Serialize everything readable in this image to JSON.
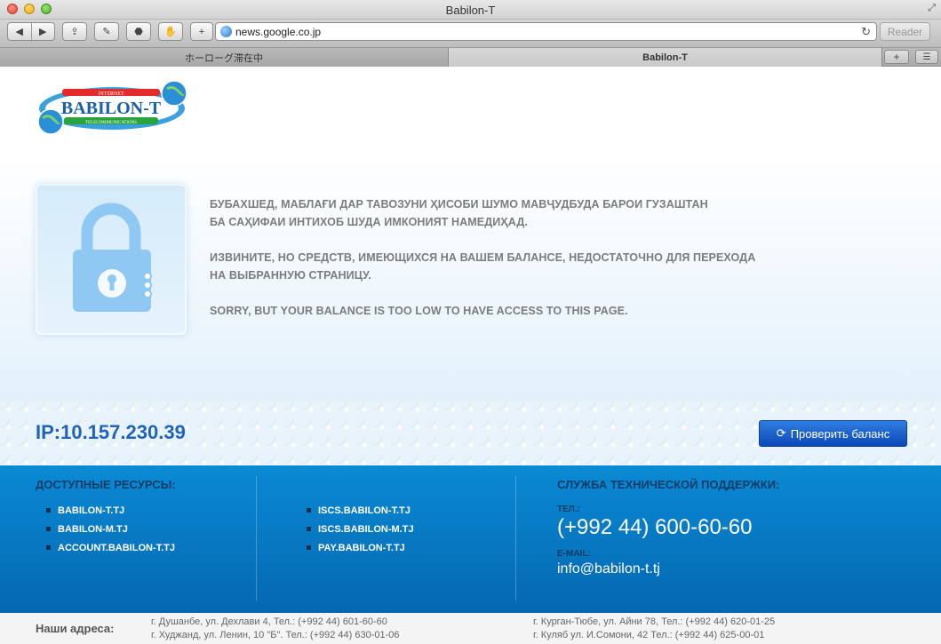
{
  "window": {
    "title": "Babilon-T"
  },
  "toolbar": {
    "back_icon": "back-arrow",
    "forward_icon": "forward-arrow",
    "url": "news.google.co.jp",
    "reader_label": "Reader"
  },
  "tabs": [
    {
      "label": "ホーローグ滞在中",
      "active": false
    },
    {
      "label": "Babilon-T",
      "active": true
    }
  ],
  "logo": {
    "top_banner": "INTERNET",
    "name": "BABILON-T",
    "bottom_banner": "TELECOMMUNICATIONS"
  },
  "message": {
    "tajik_line1": "БУБАХШЕД, МАБЛАҒИ ДАР ТАВОЗУНИ ҲИСОБИ ШУМО МАВҶУДБУДА БАРОИ ГУЗАШТАН",
    "tajik_line2": "БА САҲИФАИ ИНТИХОБ ШУДА ИМКОНИЯТ НАМЕДИҲАД.",
    "russian_line1": "ИЗВИНИТЕ, НО СРЕДСТВ, ИМЕЮЩИХСЯ НА ВАШЕМ БАЛАНСЕ, НЕДОСТАТОЧНО ДЛЯ ПЕРЕХОДА",
    "russian_line2": "НА ВЫБРАННУЮ СТРАНИЦУ.",
    "english": "SORRY, BUT YOUR BALANCE IS TOO LOW TO HAVE ACCESS TO THIS PAGE."
  },
  "ip": "IP:10.157.230.39",
  "check_balance_label": "Проверить баланс",
  "resources": {
    "heading": "ДОСТУПНЫЕ РЕСУРСЫ:",
    "col1": [
      "BABILON-T.TJ",
      "BABILON-M.TJ",
      "ACCOUNT.BABILON-T.TJ"
    ],
    "col2": [
      "ISCS.BABILON-T.TJ",
      "ISCS.BABILON-M.TJ",
      "PAY.BABILON-T.TJ"
    ]
  },
  "support": {
    "heading": "СЛУЖБА ТЕХНИЧЕСКОЙ ПОДДЕРЖКИ:",
    "phone_label": "ТЕЛ.:",
    "phone": "(+992 44) 600-60-60",
    "email_label": "E-MAIL:",
    "email": "info@babilon-t.tj"
  },
  "addresses": {
    "title": "Наши адреса:",
    "lines": [
      "г. Душанбе, ул. Дехлави 4, Тел.: (+992 44) 601-60-60",
      "г. Худжанд, ул. Ленин, 10 \"Б\". Тел.: (+992 44) 630-01-06",
      "г. Курган-Тюбе, ул. Айни 78, Тел.: (+992 44) 620-01-25",
      "г. Куляб ул. И.Сомони, 42 Тел.: (+992 44) 625-00-01"
    ]
  }
}
